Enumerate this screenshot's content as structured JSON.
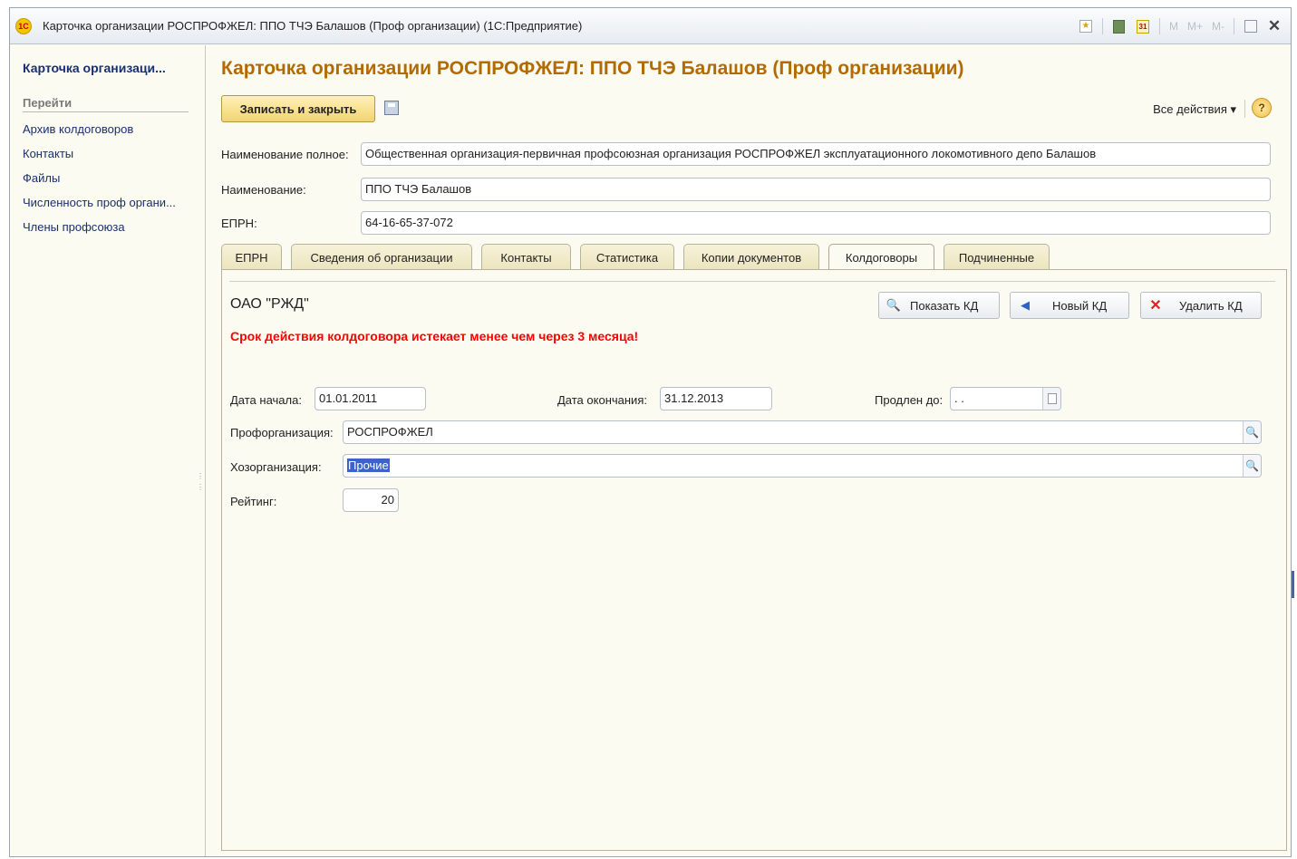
{
  "window": {
    "title": "Карточка организации РОСПРОФЖЕЛ: ППО ТЧЭ Балашов (Проф организации) (1С:Предприятие)",
    "logo_text": "1С",
    "memory_buttons": [
      "M",
      "M+",
      "M-"
    ]
  },
  "sidebar": {
    "title": "Карточка организаци...",
    "section": "Перейти",
    "links": [
      "Архив колдоговоров",
      "Контакты",
      "Файлы",
      "Численность проф органи...",
      "Члены профсоюза"
    ]
  },
  "page": {
    "title": "Карточка организации РОСПРОФЖЕЛ: ППО ТЧЭ Балашов (Проф организации)",
    "save_close_label": "Записать и закрыть",
    "all_actions_label": "Все действия ▾",
    "help_label": "?"
  },
  "fields": {
    "full_name_label": "Наименование полное:",
    "full_name_value": "Общественная организация-первичная профсоюзная организация РОСПРОФЖЕЛ эксплуатационного локомотивного депо Балашов",
    "name_label": "Наименование:",
    "name_value": "ППО ТЧЭ Балашов",
    "eprn_label": "ЕПРН:",
    "eprn_value": "64-16-65-37-072"
  },
  "tabs": [
    {
      "label": "ЕПРН"
    },
    {
      "label": "Сведения об организации"
    },
    {
      "label": "Контакты"
    },
    {
      "label": "Статистика"
    },
    {
      "label": "Копии документов"
    },
    {
      "label": "Колдоговоры"
    },
    {
      "label": "Подчиненные"
    }
  ],
  "active_tab": "Колдоговоры",
  "agreement": {
    "org_name": "ОАО \"РЖД\"",
    "show_kd_label": "Показать КД",
    "new_kd_label": "Новый КД",
    "delete_kd_label": "Удалить КД",
    "warning": "Срок действия колдоговора истекает менее чем через 3 месяца!",
    "start_label": "Дата начала:",
    "start_value": "01.01.2011",
    "end_label": "Дата окончания:",
    "end_value": "31.12.2013",
    "extended_label": "Продлен до:",
    "extended_value": " . .",
    "proforg_label": "Профорганизация:",
    "proforg_value": "РОСПРОФЖЕЛ",
    "hozorg_label": "Хозорганизация:",
    "hozorg_value": "Прочие",
    "rating_label": "Рейтинг:",
    "rating_value": "20"
  },
  "colors": {
    "title_accent": "#b36b00",
    "warning": "#ff0000",
    "link": "#1a2f6d"
  }
}
